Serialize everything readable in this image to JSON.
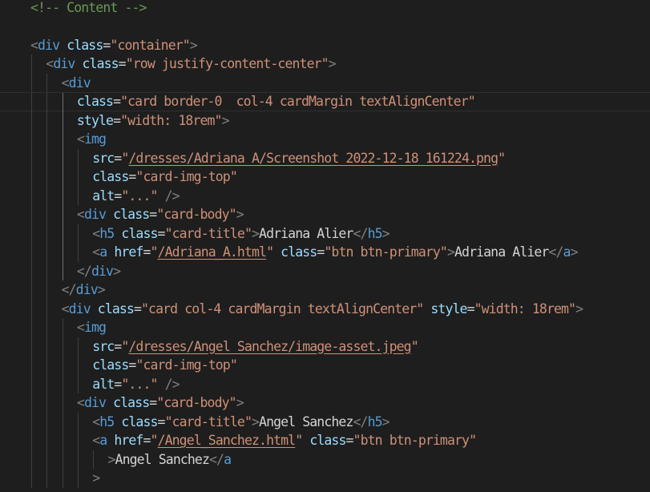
{
  "lines": [
    {
      "tokens": [
        {
          "t": "<!-- Content -->",
          "c": "comment"
        }
      ]
    },
    {
      "tokens": []
    },
    {
      "tokens": [
        {
          "t": "<",
          "c": "punct"
        },
        {
          "t": "div",
          "c": "tag"
        },
        {
          "t": " "
        },
        {
          "t": "class",
          "c": "attr"
        },
        {
          "t": "=",
          "c": "eq"
        },
        {
          "t": "\"container\"",
          "c": "str"
        },
        {
          "t": ">",
          "c": "punct"
        }
      ]
    },
    {
      "tokens": [
        {
          "t": "<",
          "c": "punct"
        },
        {
          "t": "div",
          "c": "tag"
        },
        {
          "t": " "
        },
        {
          "t": "class",
          "c": "attr"
        },
        {
          "t": "=",
          "c": "eq"
        },
        {
          "t": "\"row justify-content-center\"",
          "c": "str"
        },
        {
          "t": ">",
          "c": "punct"
        }
      ]
    },
    {
      "tokens": [
        {
          "t": "<",
          "c": "punct"
        },
        {
          "t": "div",
          "c": "tag"
        }
      ]
    },
    {
      "tokens": [
        {
          "t": "class",
          "c": "attr"
        },
        {
          "t": "=",
          "c": "eq"
        },
        {
          "t": "\"card border-0  col-4 cardMargin textAlignCenter\"",
          "c": "str"
        }
      ]
    },
    {
      "tokens": [
        {
          "t": "style",
          "c": "attr"
        },
        {
          "t": "=",
          "c": "eq"
        },
        {
          "t": "\"width: 18rem\"",
          "c": "str"
        },
        {
          "t": ">",
          "c": "punct"
        }
      ]
    },
    {
      "tokens": [
        {
          "t": "<",
          "c": "punct"
        },
        {
          "t": "img",
          "c": "tag"
        }
      ]
    },
    {
      "tokens": [
        {
          "t": "src",
          "c": "attr"
        },
        {
          "t": "=",
          "c": "eq"
        },
        {
          "t": "\"",
          "c": "str"
        },
        {
          "t": "/dresses/Adriana A/Screenshot 2022-12-18 161224.png",
          "c": "link"
        },
        {
          "t": "\"",
          "c": "str"
        }
      ]
    },
    {
      "tokens": [
        {
          "t": "class",
          "c": "attr"
        },
        {
          "t": "=",
          "c": "eq"
        },
        {
          "t": "\"card-img-top\"",
          "c": "str"
        }
      ]
    },
    {
      "tokens": [
        {
          "t": "alt",
          "c": "attr"
        },
        {
          "t": "=",
          "c": "eq"
        },
        {
          "t": "\"...\"",
          "c": "str"
        },
        {
          "t": " "
        },
        {
          "t": "/>",
          "c": "punct"
        }
      ]
    },
    {
      "tokens": [
        {
          "t": "<",
          "c": "punct"
        },
        {
          "t": "div",
          "c": "tag"
        },
        {
          "t": " "
        },
        {
          "t": "class",
          "c": "attr"
        },
        {
          "t": "=",
          "c": "eq"
        },
        {
          "t": "\"card-body\"",
          "c": "str"
        },
        {
          "t": ">",
          "c": "punct"
        }
      ]
    },
    {
      "tokens": [
        {
          "t": "<",
          "c": "punct"
        },
        {
          "t": "h5",
          "c": "tag"
        },
        {
          "t": " "
        },
        {
          "t": "class",
          "c": "attr"
        },
        {
          "t": "=",
          "c": "eq"
        },
        {
          "t": "\"card-title\"",
          "c": "str"
        },
        {
          "t": ">",
          "c": "punct"
        },
        {
          "t": "Adriana Alier",
          "c": "text"
        },
        {
          "t": "</",
          "c": "punct"
        },
        {
          "t": "h5",
          "c": "tag"
        },
        {
          "t": ">",
          "c": "punct"
        }
      ]
    },
    {
      "tokens": [
        {
          "t": "<",
          "c": "punct"
        },
        {
          "t": "a",
          "c": "tag"
        },
        {
          "t": " "
        },
        {
          "t": "href",
          "c": "attr"
        },
        {
          "t": "=",
          "c": "eq"
        },
        {
          "t": "\"",
          "c": "str"
        },
        {
          "t": "/Adriana_A.html",
          "c": "link"
        },
        {
          "t": "\"",
          "c": "str"
        },
        {
          "t": " "
        },
        {
          "t": "class",
          "c": "attr"
        },
        {
          "t": "=",
          "c": "eq"
        },
        {
          "t": "\"btn btn-primary\"",
          "c": "str"
        },
        {
          "t": ">",
          "c": "punct"
        },
        {
          "t": "Adriana Alier",
          "c": "text"
        },
        {
          "t": "</",
          "c": "punct"
        },
        {
          "t": "a",
          "c": "tag"
        },
        {
          "t": ">",
          "c": "punct"
        }
      ]
    },
    {
      "tokens": [
        {
          "t": "</",
          "c": "punct"
        },
        {
          "t": "div",
          "c": "tag"
        },
        {
          "t": ">",
          "c": "punct"
        }
      ]
    },
    {
      "tokens": [
        {
          "t": "</",
          "c": "punct"
        },
        {
          "t": "div",
          "c": "tag"
        },
        {
          "t": ">",
          "c": "punct"
        }
      ]
    },
    {
      "tokens": [
        {
          "t": "<",
          "c": "punct"
        },
        {
          "t": "div",
          "c": "tag"
        },
        {
          "t": " "
        },
        {
          "t": "class",
          "c": "attr"
        },
        {
          "t": "=",
          "c": "eq"
        },
        {
          "t": "\"card col-4 cardMargin textAlignCenter\"",
          "c": "str"
        },
        {
          "t": " "
        },
        {
          "t": "style",
          "c": "attr"
        },
        {
          "t": "=",
          "c": "eq"
        },
        {
          "t": "\"width: 18rem\"",
          "c": "str"
        },
        {
          "t": ">",
          "c": "punct"
        }
      ]
    },
    {
      "tokens": [
        {
          "t": "<",
          "c": "punct"
        },
        {
          "t": "img",
          "c": "tag"
        }
      ]
    },
    {
      "tokens": [
        {
          "t": "src",
          "c": "attr"
        },
        {
          "t": "=",
          "c": "eq"
        },
        {
          "t": "\"",
          "c": "str"
        },
        {
          "t": "/dresses/Angel Sanchez/image-asset.jpeg",
          "c": "link"
        },
        {
          "t": "\"",
          "c": "str"
        }
      ]
    },
    {
      "tokens": [
        {
          "t": "class",
          "c": "attr"
        },
        {
          "t": "=",
          "c": "eq"
        },
        {
          "t": "\"card-img-top\"",
          "c": "str"
        }
      ]
    },
    {
      "tokens": [
        {
          "t": "alt",
          "c": "attr"
        },
        {
          "t": "=",
          "c": "eq"
        },
        {
          "t": "\"...\"",
          "c": "str"
        },
        {
          "t": " "
        },
        {
          "t": "/>",
          "c": "punct"
        }
      ]
    },
    {
      "tokens": [
        {
          "t": "<",
          "c": "punct"
        },
        {
          "t": "div",
          "c": "tag"
        },
        {
          "t": " "
        },
        {
          "t": "class",
          "c": "attr"
        },
        {
          "t": "=",
          "c": "eq"
        },
        {
          "t": "\"card-body\"",
          "c": "str"
        },
        {
          "t": ">",
          "c": "punct"
        }
      ]
    },
    {
      "tokens": [
        {
          "t": "<",
          "c": "punct"
        },
        {
          "t": "h5",
          "c": "tag"
        },
        {
          "t": " "
        },
        {
          "t": "class",
          "c": "attr"
        },
        {
          "t": "=",
          "c": "eq"
        },
        {
          "t": "\"card-title\"",
          "c": "str"
        },
        {
          "t": ">",
          "c": "punct"
        },
        {
          "t": "Angel Sanchez",
          "c": "text"
        },
        {
          "t": "</",
          "c": "punct"
        },
        {
          "t": "h5",
          "c": "tag"
        },
        {
          "t": ">",
          "c": "punct"
        }
      ]
    },
    {
      "tokens": [
        {
          "t": "<",
          "c": "punct"
        },
        {
          "t": "a",
          "c": "tag"
        },
        {
          "t": " "
        },
        {
          "t": "href",
          "c": "attr"
        },
        {
          "t": "=",
          "c": "eq"
        },
        {
          "t": "\"",
          "c": "str"
        },
        {
          "t": "/Angel_Sanchez.html",
          "c": "link"
        },
        {
          "t": "\"",
          "c": "str"
        },
        {
          "t": " "
        },
        {
          "t": "class",
          "c": "attr"
        },
        {
          "t": "=",
          "c": "eq"
        },
        {
          "t": "\"btn btn-primary\"",
          "c": "str"
        }
      ]
    },
    {
      "tokens": [
        {
          "t": ">",
          "c": "punct"
        },
        {
          "t": "Angel Sanchez",
          "c": "text"
        },
        {
          "t": "</",
          "c": "punct"
        },
        {
          "t": "a",
          "c": "tag"
        }
      ]
    },
    {
      "tokens": [
        {
          "t": ">",
          "c": "punct"
        }
      ]
    }
  ]
}
